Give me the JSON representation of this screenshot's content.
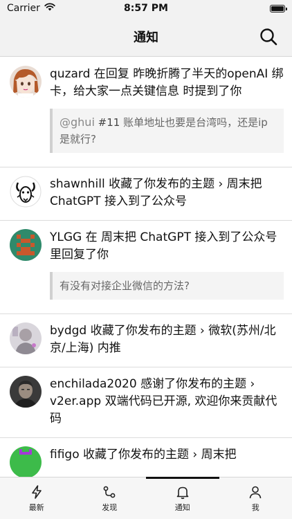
{
  "status_bar": {
    "carrier": "Carrier",
    "time": "8:57 PM"
  },
  "nav": {
    "title": "通知",
    "search_icon": "search-icon"
  },
  "notifications": [
    {
      "avatar": "anime-avatar",
      "text": "quzard 在回复 昨晚折腾了半天的openAI 绑卡，给大家一点关键信息 时提到了你",
      "quote_mention": "@ghui",
      "quote_num": " #11",
      "quote_text": " 账单地址也要是台湾吗，还是ip 是就行?"
    },
    {
      "avatar": "goat-avatar",
      "text": "shawnhill 收藏了你发布的主题 › 周末把ChatGPT 接入到了公众号"
    },
    {
      "avatar": "pixel-avatar",
      "text": "YLGG 在 周末把 ChatGPT 接入到了公众号 里回复了你",
      "quote_text": "有没有对接企业微信的方法?"
    },
    {
      "avatar": "photo-avatar",
      "text": "bydgd 收藏了你发布的主题 › 微软(苏州/北京/上海) 内推"
    },
    {
      "avatar": "portrait-avatar",
      "text": "enchilada2020 感谢了你发布的主题 › v2er.app 双端代码已开源, 欢迎你来贡献代码"
    },
    {
      "avatar": "green-avatar",
      "text": "fifigo 收藏了你发布的主题 › 周末把"
    }
  ],
  "tabs": [
    {
      "label": "最新",
      "icon": "bolt-icon"
    },
    {
      "label": "发现",
      "icon": "discover-icon"
    },
    {
      "label": "通知",
      "icon": "bell-icon"
    },
    {
      "label": "我",
      "icon": "person-icon"
    }
  ],
  "active_tab": 2,
  "colors": {
    "bar_bg": "#f2f2f2",
    "quote_bg": "#f4f4f4",
    "quote_border": "#d0d0d0",
    "pixel_avatar": "#2f8a6b",
    "pixel_avatar_accent": "#c8582c",
    "green_avatar": "#3dbb4a",
    "purple_accent": "#a33bd6"
  }
}
